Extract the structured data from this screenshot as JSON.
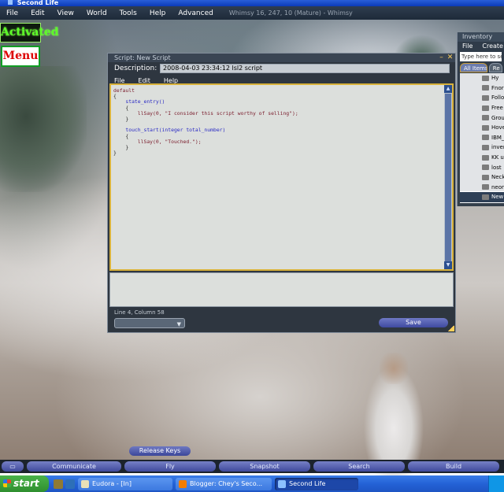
{
  "window_title": "Second Life",
  "menubar": {
    "items": [
      "File",
      "Edit",
      "View",
      "World",
      "Tools",
      "Help",
      "Advanced"
    ],
    "location": "Whimsy 16, 247, 10 (Mature) - Whimsy"
  },
  "hud": {
    "activated": "Activated",
    "menu": "Menu"
  },
  "inventory": {
    "title": "Inventory",
    "menu": [
      "File",
      "Create"
    ],
    "search_placeholder": "Type here to search",
    "tabs": [
      "All Items",
      "Re"
    ],
    "items": [
      "Hy",
      "Fnor",
      "Follo",
      "Free",
      "Grou",
      "Hove",
      "IBM_",
      "inven",
      "KK u",
      "lost",
      "Neck",
      "neon",
      "New"
    ]
  },
  "editor": {
    "title": "Script: New Script",
    "description_label": "Description:",
    "description_value": "2008-04-03 23:34:12 lsl2 script",
    "menu": [
      "File",
      "Edit",
      "Help"
    ],
    "code_lines": [
      "default",
      "{",
      "    state_entry()",
      "    {",
      "        llSay(0, \"I consider this script worthy of selling\");",
      "    }",
      "",
      "    touch_start(integer total_number)",
      "    {",
      "        llSay(0, \"Touched.\");",
      "    }",
      "}"
    ],
    "status": "Line 4, Column 58",
    "save_label": "Save"
  },
  "release_keys": "Release Keys",
  "sl_toolbar": {
    "buttons": [
      "Communicate",
      "Fly",
      "Snapshot",
      "Search",
      "Build"
    ]
  },
  "taskbar": {
    "start": "start",
    "tasks": [
      {
        "label": "Eudora - [In]",
        "active": false,
        "icon_color": "#e9e0b7"
      },
      {
        "label": "Blogger: Chey's Seco...",
        "active": false,
        "icon_color": "#f57d00"
      },
      {
        "label": "Second Life",
        "active": true,
        "icon_color": "#8cc0ff"
      }
    ]
  },
  "colors": {
    "editor_border_accent": "#d9b23b",
    "button_gradient_top": "#6f79c5",
    "hud_green": "#5dff28",
    "hud_red": "#dd0000"
  }
}
